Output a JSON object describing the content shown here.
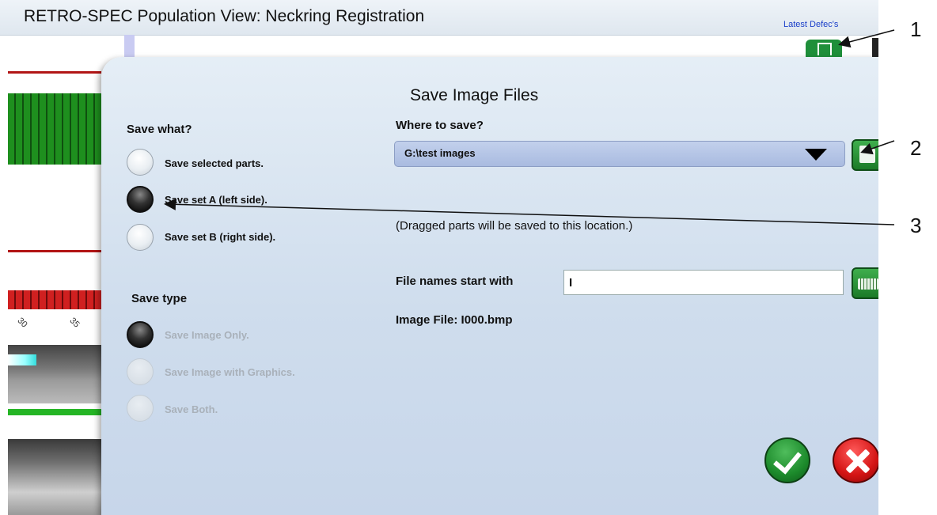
{
  "app": {
    "title": "RETRO-SPEC Population View:  Neckring Registration",
    "latest_defects_label": "Latest Defec's",
    "tick_labels": [
      "30",
      "35"
    ]
  },
  "dialog": {
    "title": "Save Image Files",
    "save_what": {
      "label": "Save what?",
      "options": [
        {
          "label": "Save selected parts.",
          "selected": false,
          "enabled": true
        },
        {
          "label": "Save set A (left side).",
          "selected": true,
          "enabled": true
        },
        {
          "label": "Save set B (right side).",
          "selected": false,
          "enabled": true
        }
      ]
    },
    "save_type": {
      "label": "Save type",
      "options": [
        {
          "label": "Save Image Only.",
          "selected": true,
          "enabled": false
        },
        {
          "label": "Save Image with Graphics.",
          "selected": false,
          "enabled": false
        },
        {
          "label": "Save Both.",
          "selected": false,
          "enabled": false
        }
      ]
    },
    "where_to_save": {
      "label": "Where to save?",
      "selected": "G:\\test images"
    },
    "drag_note": "(Dragged parts will be saved to this location.)",
    "file_names": {
      "label": "File names start with",
      "value": "I"
    },
    "image_file_label": "Image File: I000.bmp"
  },
  "callouts": [
    "1",
    "2",
    "3"
  ],
  "colors": {
    "accent_green": "#1f8f3a",
    "cancel_red": "#d41414",
    "dropdown_blue": "#b3c3e6"
  },
  "icons": {
    "ok": "checkmark-icon",
    "cancel": "x-icon",
    "browse": "folder-icon",
    "keyboard": "keyboard-icon",
    "dropdown": "triangle-down-icon"
  }
}
